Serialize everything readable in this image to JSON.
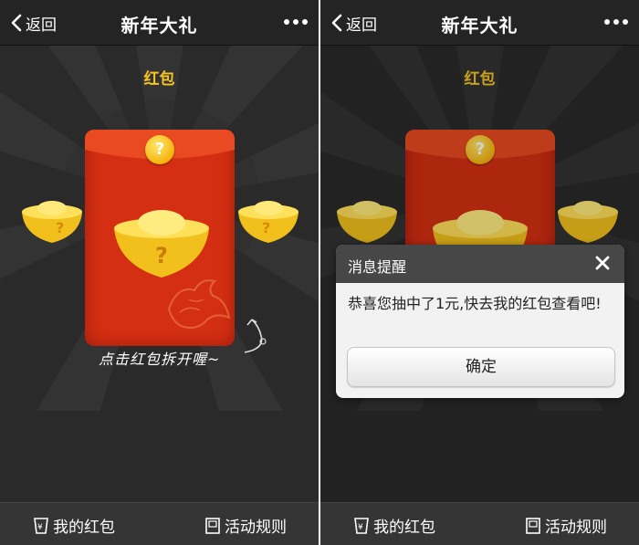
{
  "header": {
    "back_label": "返回",
    "title": "新年大礼"
  },
  "content": {
    "section_label": "红包",
    "hint": "点击红包拆开喔~",
    "question_mark": "?"
  },
  "footer": {
    "my_red_packets": "我的红包",
    "activity_rules": "活动规则"
  },
  "dialog": {
    "title": "消息提醒",
    "message": "恭喜您抽中了1元,快去我的红包查看吧!",
    "ok_label": "确定"
  },
  "colors": {
    "accent_gold": "#f6c521",
    "envelope_red": "#d42f12",
    "background": "#2a2a2a"
  },
  "icons": [
    "chevron-left-icon",
    "more-dots-icon",
    "cup-yuan-icon",
    "rules-book-icon",
    "close-icon",
    "curved-arrow-icon"
  ]
}
